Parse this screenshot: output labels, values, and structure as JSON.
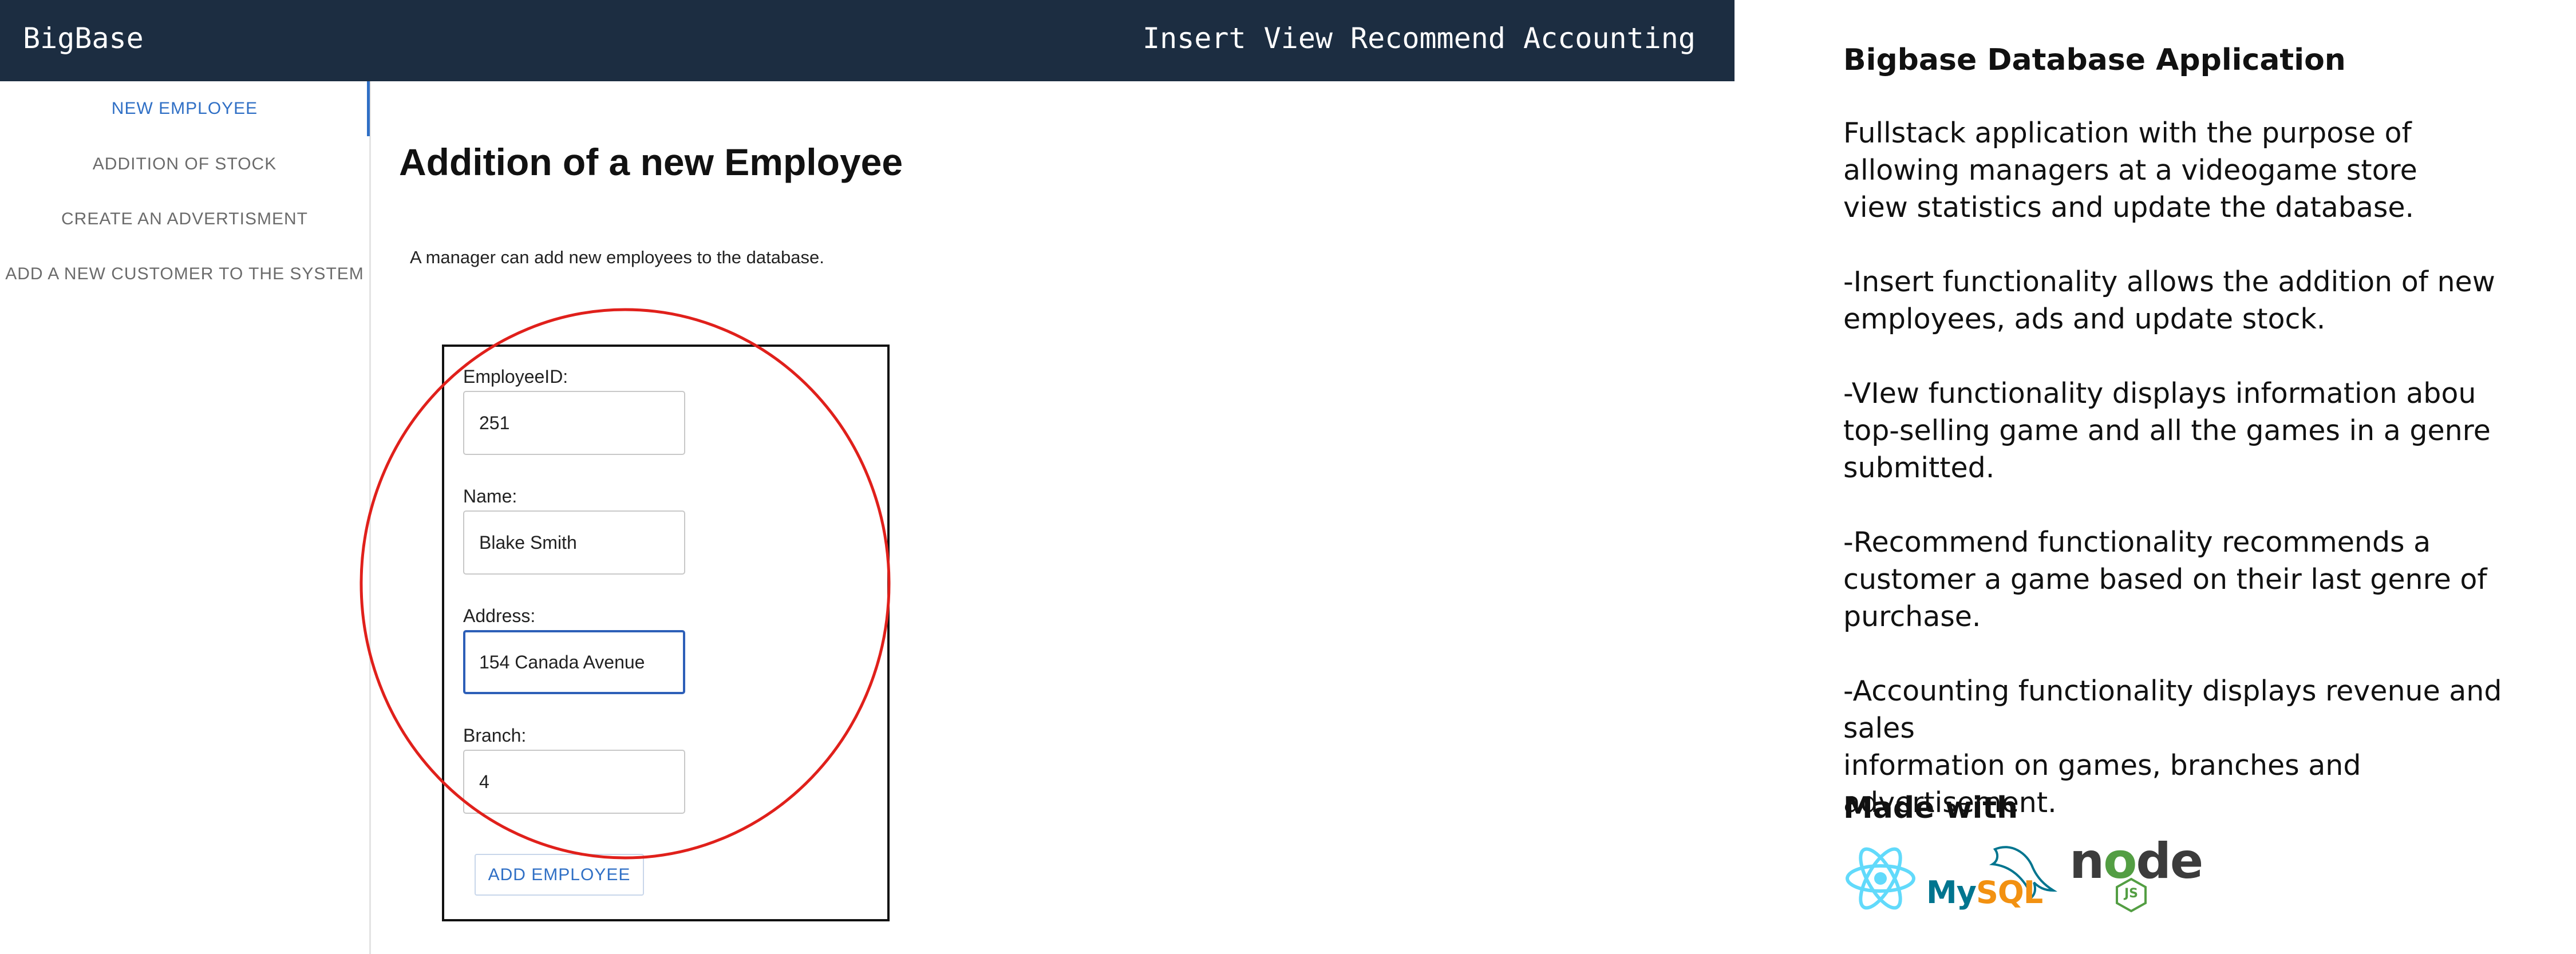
{
  "app": {
    "brand": "BigBase",
    "topnav": [
      "Insert",
      "View",
      "Recommend",
      "Accounting"
    ],
    "sidebar": [
      {
        "label": "NEW EMPLOYEE",
        "active": true
      },
      {
        "label": "ADDITION OF STOCK",
        "active": false
      },
      {
        "label": "CREATE AN ADVERTISMENT",
        "active": false
      },
      {
        "label": "ADD A NEW CUSTOMER TO THE SYSTEM",
        "active": false
      }
    ],
    "page_title": "Addition of a new Employee",
    "page_description": "A manager can add new employees to the database.",
    "form": {
      "fields": [
        {
          "label": "EmployeeID:",
          "value": "251",
          "focused": false
        },
        {
          "label": "Name:",
          "value": "Blake Smith",
          "focused": false
        },
        {
          "label": "Address:",
          "value": "154 Canada Avenue",
          "focused": true
        },
        {
          "label": "Branch:",
          "value": "4",
          "focused": false
        }
      ],
      "submit_label": "ADD EMPLOYEE"
    }
  },
  "info": {
    "title": "Bigbase Database Application",
    "paragraphs": [
      "Fullstack application with the purpose of\nallowing managers at a videogame store\nview statistics and update the database.",
      "-Insert functionality allows the addition of new\nemployees, ads and update stock.",
      "-VIew functionality displays information abou\ntop-selling game and all the games in a genre\nsubmitted.",
      "-Recommend functionality recommends a\ncustomer a game based on their last genre of\npurchase.",
      "-Accounting functionality displays revenue and sales\ninformation on games, branches and advertisement."
    ],
    "made_with": "Made with",
    "logos": [
      {
        "name": "react-logo",
        "color": "#61dafb"
      },
      {
        "name": "mysql-logo",
        "text_my": "My",
        "text_sql": "SQL",
        "color_my": "#00758f",
        "color_sql": "#f29111"
      },
      {
        "name": "nodejs-logo",
        "text_n": "n",
        "text_o": "o",
        "text_de": "de",
        "text_js": "JS",
        "color": "#3c3c3c",
        "accent": "#539e43"
      }
    ]
  },
  "colors": {
    "topbar": "#1c2d41",
    "accent": "#2f6fc5",
    "annotation": "#e0201b"
  }
}
